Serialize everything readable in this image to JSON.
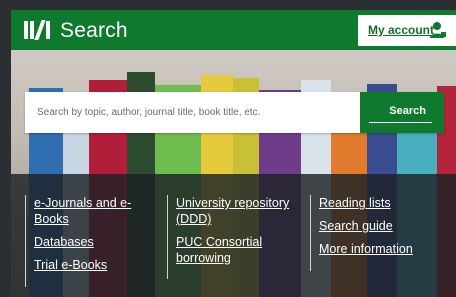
{
  "header": {
    "title": "Search",
    "account_label": "My account"
  },
  "search": {
    "placeholder": "Search by topic, author, journal title, book title, etc.",
    "button_label": "Search"
  },
  "links": {
    "col1": [
      "e-Journals and e-Books",
      "Databases",
      "Trial e-Books"
    ],
    "col2": [
      "University repository (DDD)",
      "PUC Consortial borrowing"
    ],
    "col3": [
      "Reading lists",
      "Search guide",
      "More information"
    ]
  },
  "colors": {
    "brand": "#0f7a2e",
    "overlay": "#1c2126",
    "link": "#ffffff"
  },
  "icons": {
    "logo": "institution-logo",
    "account": "user-icon"
  }
}
